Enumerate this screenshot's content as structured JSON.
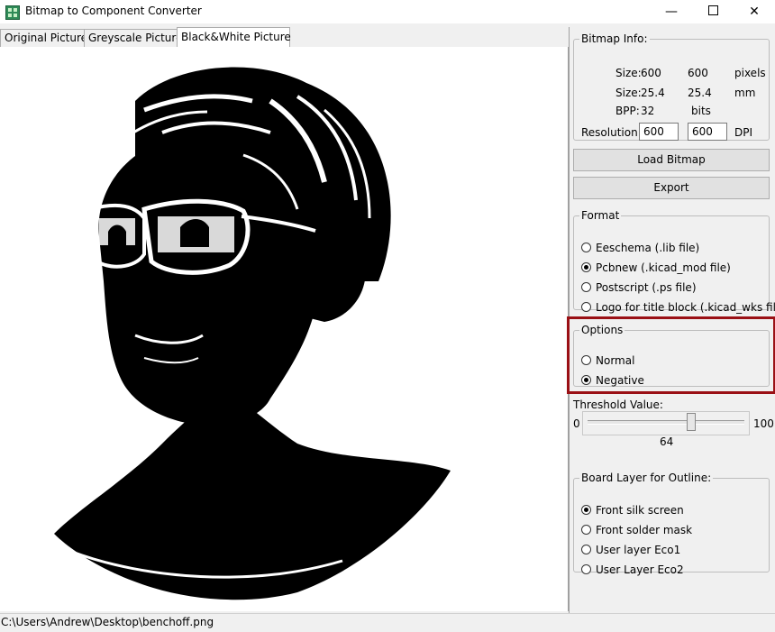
{
  "window": {
    "title": "Bitmap to Component Converter",
    "minimize_glyph": "—",
    "close_glyph": "✕"
  },
  "tabs": [
    {
      "label": "Original Picture",
      "active": false
    },
    {
      "label": "Greyscale Picture",
      "active": false
    },
    {
      "label": "Black&White Picture",
      "active": true
    }
  ],
  "bitmap_info": {
    "legend": "Bitmap Info:",
    "size_px": {
      "label": "Size:",
      "w": "600",
      "h": "600",
      "unit": "pixels"
    },
    "size_mm": {
      "label": "Size:",
      "w": "25.4",
      "h": "25.4",
      "unit": "mm"
    },
    "bpp": {
      "label": "BPP:",
      "value": "32",
      "unit": "bits"
    },
    "resolution": {
      "label": "Resolution:",
      "x": "600",
      "y": "600",
      "unit": "DPI"
    }
  },
  "buttons": {
    "load": "Load Bitmap",
    "export": "Export"
  },
  "format": {
    "legend": "Format",
    "options": [
      {
        "label": "Eeschema (.lib file)",
        "checked": false
      },
      {
        "label": "Pcbnew (.kicad_mod file)",
        "checked": true
      },
      {
        "label": "Postscript (.ps file)",
        "checked": false
      },
      {
        "label": "Logo for title block (.kicad_wks file)",
        "checked": false
      }
    ]
  },
  "options": {
    "legend": "Options",
    "items": [
      {
        "label": "Normal",
        "checked": false
      },
      {
        "label": "Negative",
        "checked": true
      }
    ]
  },
  "threshold": {
    "label": "Threshold Value:",
    "min": "0",
    "max": "100",
    "value": "64"
  },
  "board_layer": {
    "legend": "Board Layer for Outline:",
    "options": [
      {
        "label": "Front silk screen",
        "checked": true
      },
      {
        "label": "Front solder mask",
        "checked": false
      },
      {
        "label": "User layer Eco1",
        "checked": false
      },
      {
        "label": "User Layer Eco2",
        "checked": false
      }
    ]
  },
  "status": {
    "path": "C:\\Users\\Andrew\\Desktop\\benchoff.png"
  },
  "colors": {
    "highlight": "#9a1015",
    "canvas_bg": "#ffffff",
    "image_fg": "#000000"
  }
}
